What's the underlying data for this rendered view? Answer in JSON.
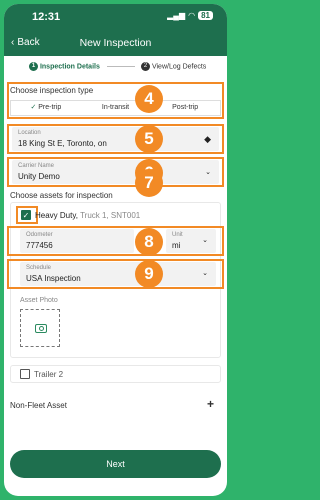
{
  "status": {
    "time": "12:31",
    "battery": "81"
  },
  "header": {
    "back_label": "Back",
    "title": "New Inspection"
  },
  "steps": [
    {
      "num": "1",
      "label": "Inspection Details"
    },
    {
      "num": "2",
      "label": "View/Log Defects"
    }
  ],
  "badges": [
    "4",
    "5",
    "6",
    "7",
    "8",
    "9"
  ],
  "inspection_type": {
    "heading": "Choose inspection type",
    "options": [
      "Pre-trip",
      "In-transit",
      "Post-trip"
    ],
    "selected": "Pre-trip"
  },
  "location": {
    "label": "Location",
    "value": "18 King St E, Toronto, on"
  },
  "carrier": {
    "label": "Carrier Name",
    "value": "Unity Demo"
  },
  "assets": {
    "heading": "Choose assets for inspection",
    "vehicle_type": "Heavy Duty",
    "vehicle_detail": "Truck 1, SNT001",
    "odometer": {
      "label": "Odometer",
      "value": "777456"
    },
    "unit": {
      "label": "Unit",
      "value": "mi"
    },
    "schedule": {
      "label": "Schedule",
      "value": "USA Inspection"
    },
    "photo_label": "Asset Photo",
    "trailer_label": "Trailer 2"
  },
  "non_fleet": {
    "label": "Non-Fleet Asset"
  },
  "next_label": "Next",
  "colors": {
    "brand": "#1e6f4e",
    "badge": "#f28a25",
    "outer_bg": "#2fb36b"
  }
}
